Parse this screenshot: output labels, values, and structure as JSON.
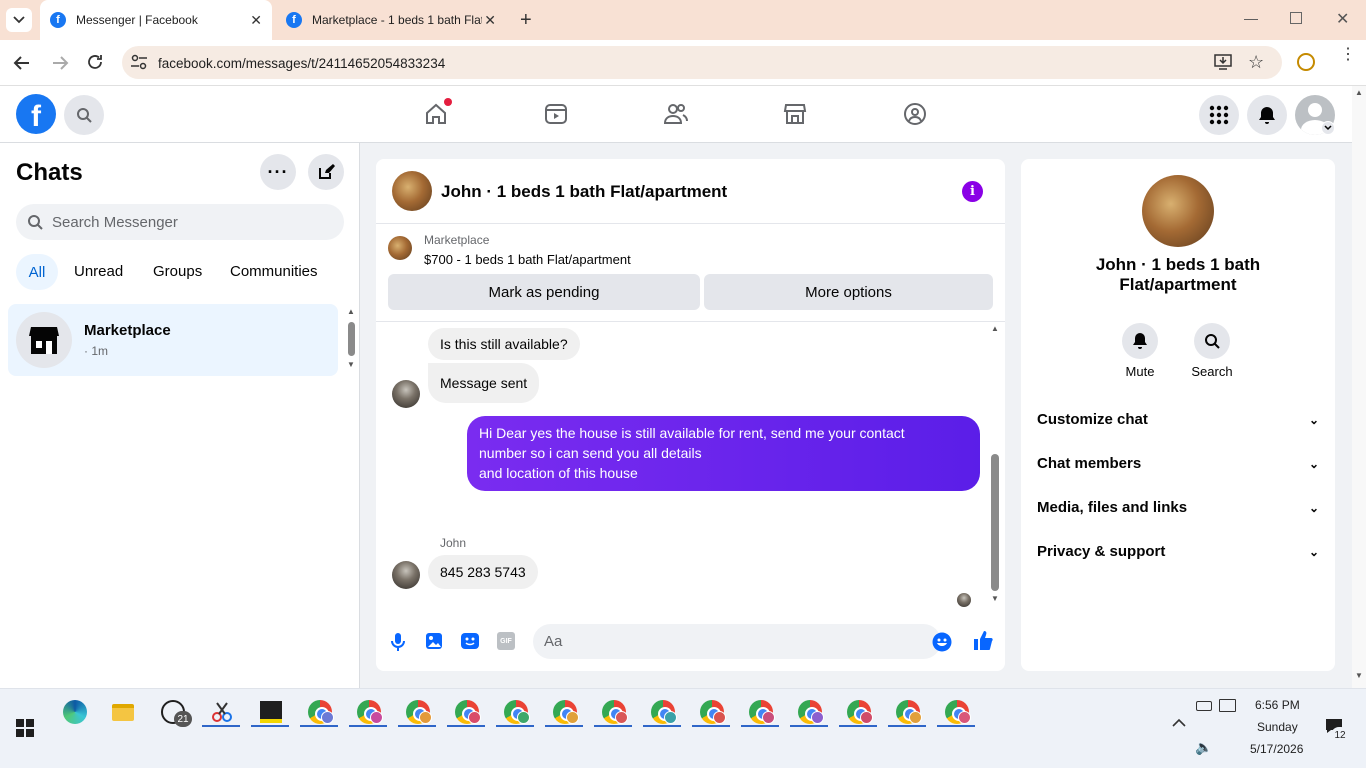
{
  "browser": {
    "tabs": [
      {
        "title": "Messenger | Facebook",
        "active": true
      },
      {
        "title": "Marketplace - 1 beds 1 bath Flat",
        "active": false
      }
    ],
    "url": "facebook.com/messages/t/24114652054833234"
  },
  "fb_header": {
    "nav_icons": [
      "home-icon",
      "video-icon",
      "friends-icon",
      "marketplace-icon",
      "groups-icon"
    ]
  },
  "chats": {
    "title": "Chats",
    "search_placeholder": "Search Messenger",
    "filters": [
      "All",
      "Unread",
      "Groups",
      "Communities"
    ],
    "items": [
      {
        "name": "Marketplace",
        "preview": "· 1m"
      }
    ]
  },
  "conversation": {
    "title": "John · 1 beds 1 bath Flat/apartment",
    "listing_label": "Marketplace",
    "listing_title": "$700 - 1 beds 1 bath Flat/apartment",
    "btn_pending": "Mark as pending",
    "btn_more": "More options",
    "messages": [
      {
        "text": "Is this still available?",
        "from": "them"
      },
      {
        "text": "Message sent",
        "from": "them"
      },
      {
        "text_lines": [
          "Hi Dear yes the house is still available for rent, send me your contact",
          "number so i can send you all details",
          "and location of this house"
        ],
        "from": "me"
      },
      {
        "sender": "John",
        "text": "845 283 5743",
        "from": "them"
      }
    ],
    "input_placeholder": "Aa"
  },
  "details": {
    "name_line1": "John · 1 beds 1 bath",
    "name_line2": "Flat/apartment",
    "mute_label": "Mute",
    "search_label": "Search",
    "sections": [
      "Customize chat",
      "Chat members",
      "Media, files and links",
      "Privacy & support"
    ]
  },
  "taskbar": {
    "whatsapp_badge": "21",
    "time": "6:56 PM",
    "day": "Sunday",
    "date": "5/17/2026",
    "notification_count": "12"
  },
  "colors": {
    "fb_blue": "#1877f2",
    "purple_bubble": "#6a27ee",
    "selected_chat_bg": "#ebf5ff"
  }
}
